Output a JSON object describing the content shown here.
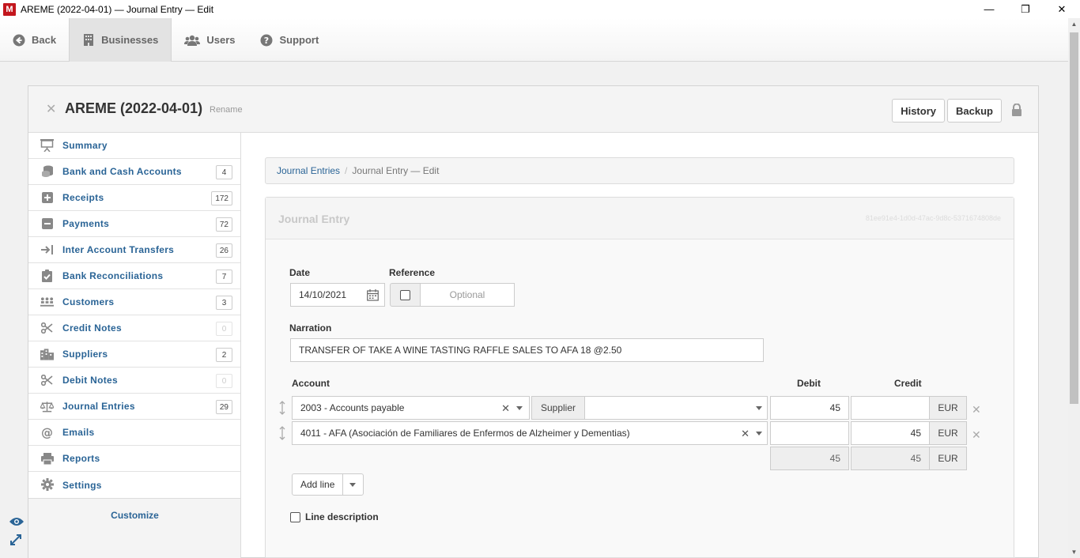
{
  "window": {
    "logo": "M",
    "title": "AREME (2022-04-01) — Journal Entry — Edit",
    "minimize": "—",
    "restore": "❐",
    "close": "✕"
  },
  "topnav": {
    "back": "Back",
    "businesses": "Businesses",
    "users": "Users",
    "support": "Support"
  },
  "business": {
    "name": "AREME (2022-04-01)",
    "rename": "Rename",
    "history": "History",
    "backup": "Backup"
  },
  "sidebar": {
    "items": [
      {
        "label": "Summary",
        "icon": "presentation-icon",
        "badge": ""
      },
      {
        "label": "Bank and Cash Accounts",
        "icon": "coins-icon",
        "badge": "4"
      },
      {
        "label": "Receipts",
        "icon": "plus-square-icon",
        "badge": "172"
      },
      {
        "label": "Payments",
        "icon": "minus-square-icon",
        "badge": "72"
      },
      {
        "label": "Inter Account Transfers",
        "icon": "transfer-icon",
        "badge": "26"
      },
      {
        "label": "Bank Reconciliations",
        "icon": "clipboard-check-icon",
        "badge": "7"
      },
      {
        "label": "Customers",
        "icon": "customers-icon",
        "badge": "3"
      },
      {
        "label": "Credit Notes",
        "icon": "scissors-icon",
        "badge": "0"
      },
      {
        "label": "Suppliers",
        "icon": "building-icon",
        "badge": "2"
      },
      {
        "label": "Debit Notes",
        "icon": "scissors-icon",
        "badge": "0"
      },
      {
        "label": "Journal Entries",
        "icon": "scale-icon",
        "badge": "29"
      },
      {
        "label": "Emails",
        "icon": "at-icon",
        "badge": ""
      },
      {
        "label": "Reports",
        "icon": "printer-icon",
        "badge": ""
      },
      {
        "label": "Settings",
        "icon": "gear-icon",
        "badge": ""
      }
    ],
    "customize": "Customize"
  },
  "breadcrumb": {
    "parent": "Journal Entries",
    "separator": "/",
    "current": "Journal Entry — Edit"
  },
  "journal": {
    "title": "Journal Entry",
    "guid": "81ee91e4-1d0d-47ac-9d8c-5371674808de",
    "date_label": "Date",
    "date_value": "14/10/2021",
    "reference_label": "Reference",
    "reference_placeholder": "Optional",
    "narration_label": "Narration",
    "narration_value": "TRANSFER OF TAKE A WINE TASTING RAFFLE SALES TO AFA 18 @2.50",
    "account_header": "Account",
    "debit_header": "Debit",
    "credit_header": "Credit",
    "lines": [
      {
        "account": "2003 - Accounts payable",
        "supplier_label": "Supplier",
        "supplier_value": "",
        "debit": "45",
        "credit": "",
        "currency": "EUR"
      },
      {
        "account": "4011 - AFA (Asociación de Familiares de Enfermos de Alzheimer y Dementias)",
        "debit": "",
        "credit": "45",
        "currency": "EUR"
      }
    ],
    "total_debit": "45",
    "total_credit": "45",
    "total_currency": "EUR",
    "add_line": "Add line",
    "line_description": "Line description"
  }
}
